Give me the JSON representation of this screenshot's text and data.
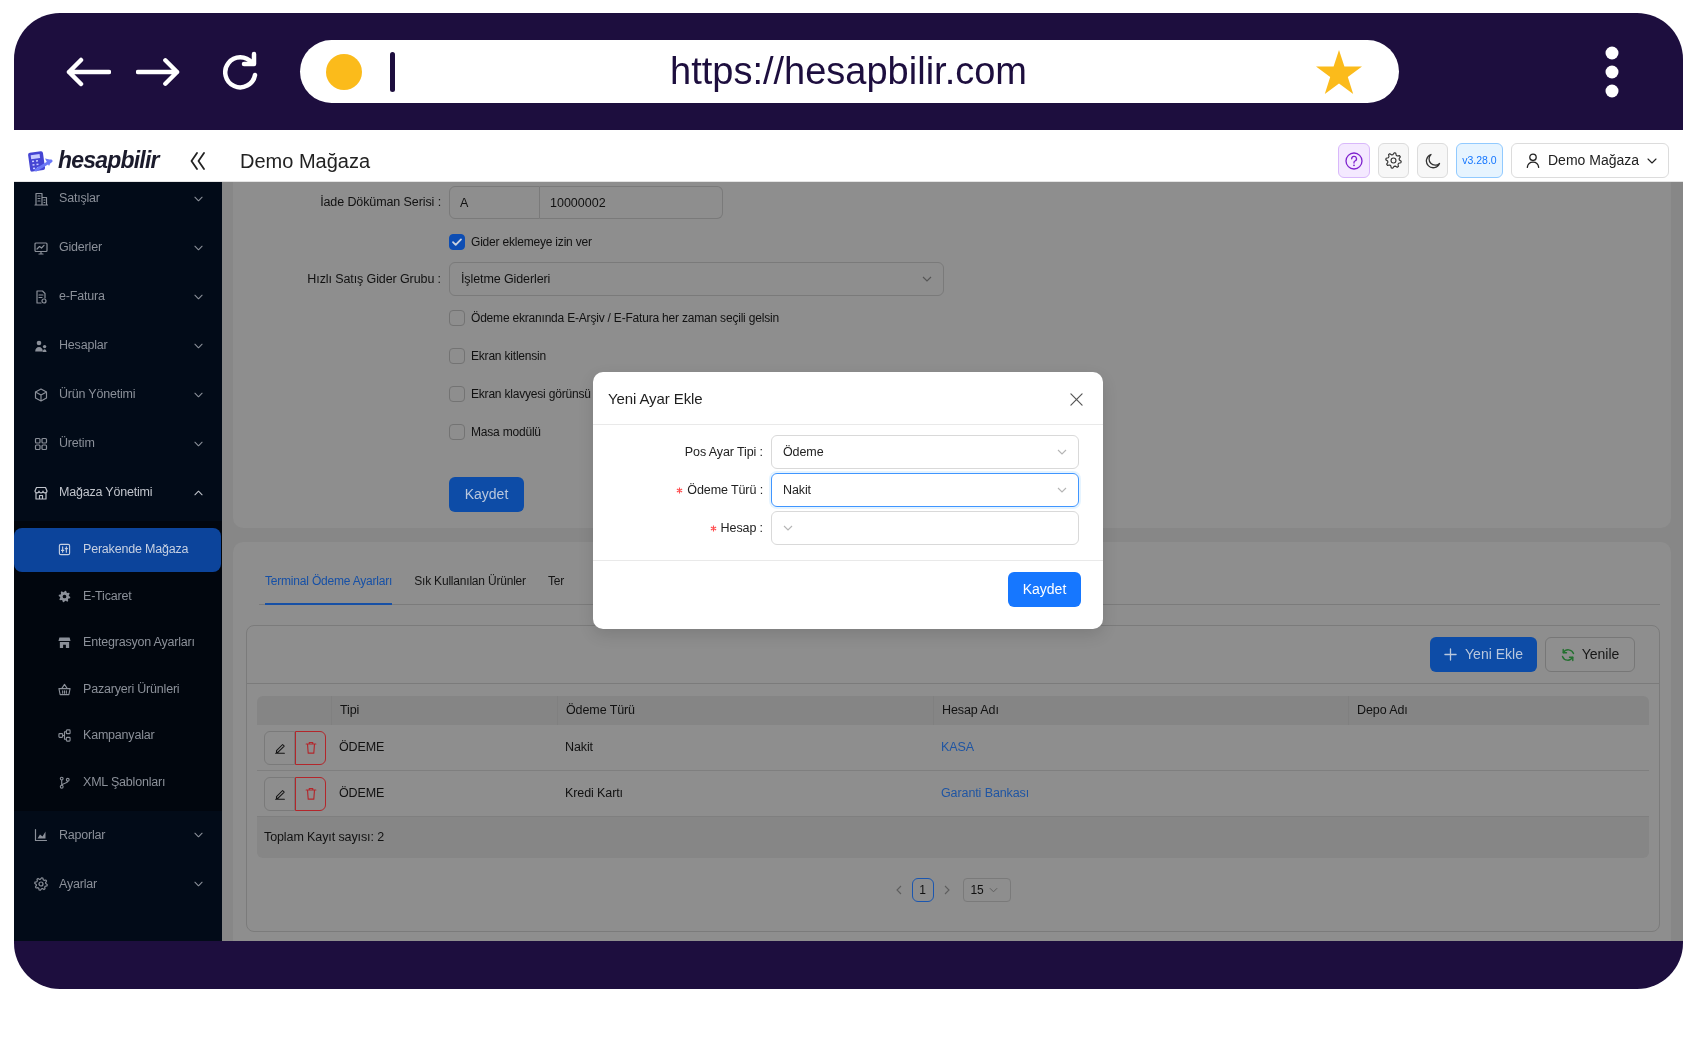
{
  "browser": {
    "url": "https://hesapbilir.com"
  },
  "header": {
    "logo": "hesapbilir",
    "title": "Demo Mağaza",
    "version": "v3.28.0",
    "user": "Demo Mağaza"
  },
  "sidebar": {
    "items": [
      {
        "label": "Satışlar",
        "expanded": false
      },
      {
        "label": "Giderler",
        "expanded": false
      },
      {
        "label": "e-Fatura",
        "expanded": false
      },
      {
        "label": "Hesaplar",
        "expanded": false
      },
      {
        "label": "Ürün Yönetimi",
        "expanded": false
      },
      {
        "label": "Üretim",
        "expanded": false
      },
      {
        "label": "Mağaza Yönetimi",
        "expanded": true,
        "children": [
          {
            "label": "Perakende Mağaza",
            "selected": true
          },
          {
            "label": "E-Ticaret",
            "selected": false
          },
          {
            "label": "Entegrasyon Ayarları",
            "selected": false
          },
          {
            "label": "Pazaryeri Ürünleri",
            "selected": false
          },
          {
            "label": "Kampanyalar",
            "selected": false
          },
          {
            "label": "XML Şablonları",
            "selected": false
          }
        ]
      },
      {
        "label": "Raporlar",
        "expanded": false
      },
      {
        "label": "Ayarlar",
        "expanded": false
      }
    ]
  },
  "settings_form": {
    "fields": [
      {
        "kind": "input_group",
        "label": "İade Döküman Serisi :",
        "values": [
          "A",
          "10000002"
        ]
      },
      {
        "kind": "checkbox",
        "label": "Gider eklemeye izin ver",
        "checked": true
      },
      {
        "kind": "select",
        "label": "Hızlı Satış Gider Grubu :",
        "value": "İşletme Giderleri"
      },
      {
        "kind": "checkbox",
        "label": "Ödeme ekranında E-Arşiv / E-Fatura her zaman seçili gelsin",
        "checked": false
      },
      {
        "kind": "checkbox",
        "label": "Ekran kitlensin",
        "checked": false
      },
      {
        "kind": "checkbox",
        "label": "Ekran klavyesi görünsü",
        "checked": false
      },
      {
        "kind": "checkbox",
        "label": "Masa modülü",
        "checked": false
      }
    ],
    "save_button": "Kaydet"
  },
  "tabs": [
    {
      "label": "Terminal Ödeme Ayarları",
      "selected": true
    },
    {
      "label": "Sık Kullanılan Ürünler",
      "selected": false
    },
    {
      "label": "Ter",
      "selected": false
    }
  ],
  "toolbar": {
    "add_button": "Yeni Ekle",
    "refresh_button": "Yenile"
  },
  "table": {
    "columns": [
      "Tipi",
      "Ödeme Türü",
      "Hesap Adı",
      "Depo Adı"
    ],
    "rows": [
      {
        "type": "ÖDEME",
        "payment_type": "Nakit",
        "account": "KASA"
      },
      {
        "type": "ÖDEME",
        "payment_type": "Kredi Kartı",
        "account": "Garanti Bankası"
      }
    ],
    "footer": "Toplam Kayıt sayısı: 2"
  },
  "pagination": {
    "pages": [
      {
        "label": "1",
        "selected": true
      }
    ],
    "page_size": "15"
  },
  "modal": {
    "title": "Yeni Ayar Ekle",
    "fields": [
      {
        "label": "Pos Ayar Tipi :",
        "required": false,
        "focused": false,
        "value": "Ödeme"
      },
      {
        "label": "Ödeme Türü :",
        "required": true,
        "focused": true,
        "value": "Nakit"
      },
      {
        "label": "Hesap :",
        "required": true,
        "focused": false
      }
    ],
    "save_button": "Kaydet"
  }
}
